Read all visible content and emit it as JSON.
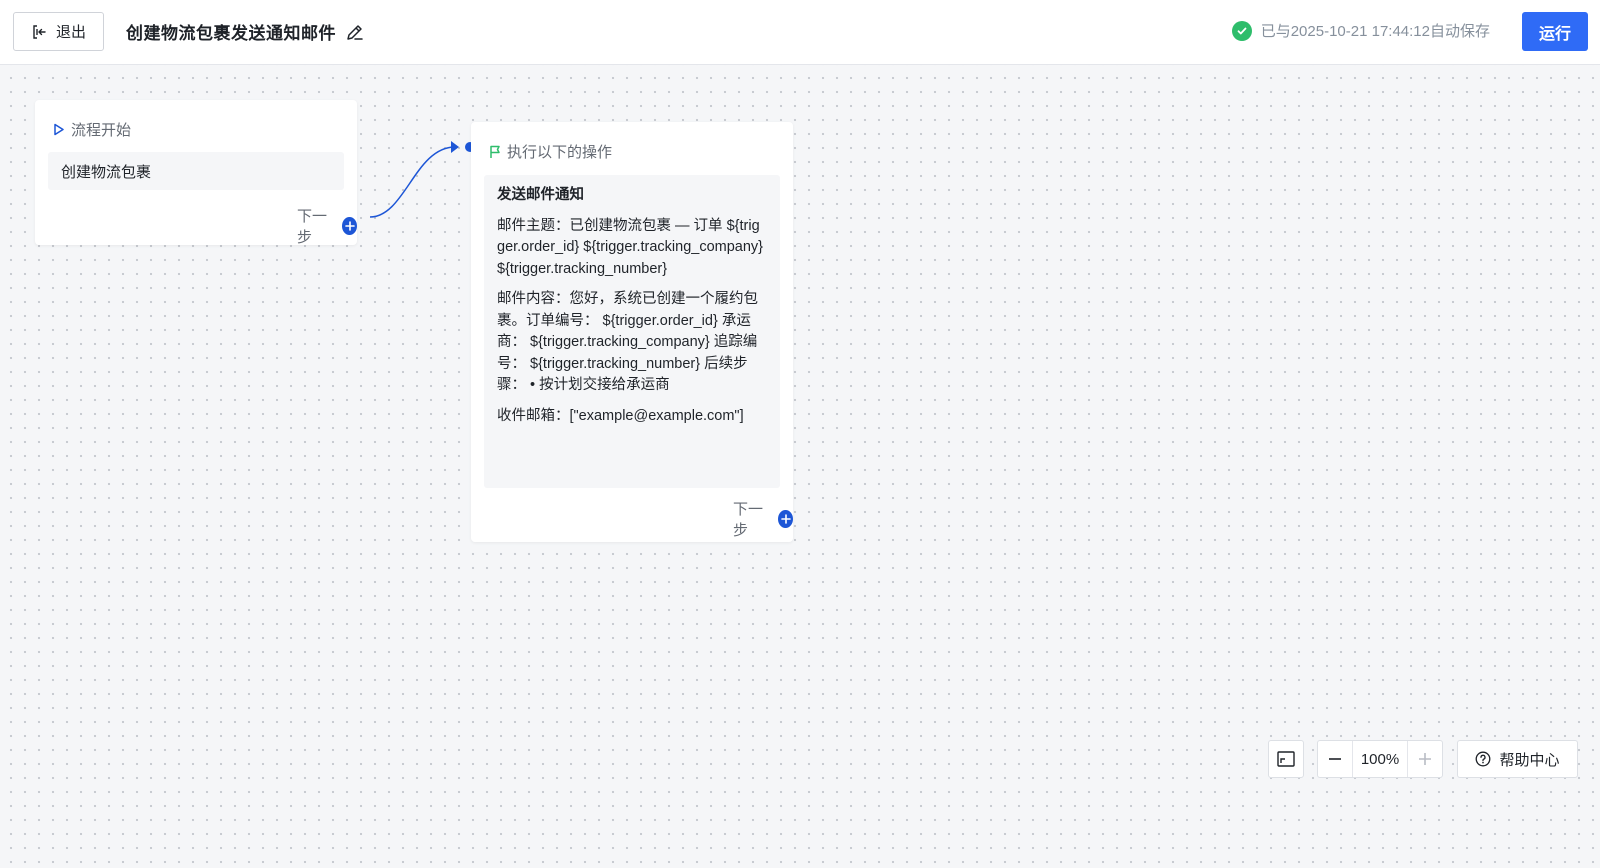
{
  "header": {
    "exit_label": "退出",
    "title": "创建物流包裹发送通知邮件",
    "save_status": "已与2025-10-21 17:44:12自动保存",
    "run_label": "运行"
  },
  "start_node": {
    "header": "流程开始",
    "trigger": "创建物流包裹",
    "next_label": "下一步"
  },
  "action_node": {
    "header": "执行以下的操作",
    "title": "发送邮件通知",
    "subject": "邮件主题：已创建物流包裹 — 订单 ${trigger.order_id} ${trigger.tracking_company} ${trigger.tracking_number}",
    "content": "邮件内容：您好，系统已创建一个履约包裹。订单编号： ${trigger.order_id} 承运商： ${trigger.tracking_company} 追踪编号： ${trigger.tracking_number} 后续步骤： • 按计划交接给承运商",
    "recipients": "收件邮箱：[\"example@example.com\"]",
    "next_label": "下一步"
  },
  "controls": {
    "zoom": "100%",
    "help_label": "帮助中心"
  },
  "colors": {
    "primary": "#2f6bf6",
    "node_accent": "#1d56d6",
    "success": "#2ebd6b",
    "flag": "#2ebd6b"
  }
}
